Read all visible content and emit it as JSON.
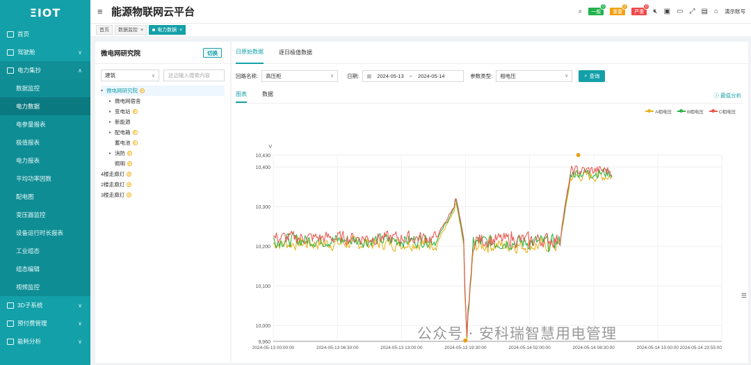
{
  "app": {
    "logo": "ΞIOT",
    "title": "能源物联网云平台"
  },
  "header": {
    "alerts": [
      {
        "label": "一般",
        "count": "0",
        "color": "#21b24b"
      },
      {
        "label": "重要",
        "count": "0",
        "color": "#f0a012"
      },
      {
        "label": "严重",
        "count": "0",
        "color": "#f0484a"
      }
    ],
    "user": "演示账号"
  },
  "sidebar": {
    "items": [
      {
        "label": "首页"
      },
      {
        "label": "驾驶舱",
        "has_children": true
      },
      {
        "label": "电力集抄",
        "has_children": true,
        "open": true
      }
    ],
    "sub_items": [
      {
        "label": "数据监控"
      },
      {
        "label": "电力数据",
        "active": true
      },
      {
        "label": "电参量报表"
      },
      {
        "label": "极值报表"
      },
      {
        "label": "电力报表"
      },
      {
        "label": "平均功率因数"
      },
      {
        "label": "配电图"
      },
      {
        "label": "变压器监控"
      },
      {
        "label": "设备运行时长报表"
      },
      {
        "label": "工业组态"
      },
      {
        "label": "组态编辑"
      },
      {
        "label": "视频监控"
      }
    ],
    "bottom_items": [
      {
        "label": "3D子系统"
      },
      {
        "label": "预付费管理"
      },
      {
        "label": "能耗分析"
      }
    ]
  },
  "tabs": [
    {
      "label": "首页"
    },
    {
      "label": "数据监控"
    },
    {
      "label": "电力数据",
      "active": true
    }
  ],
  "tree_panel": {
    "title": "微电网研究院",
    "switch_label": "切换",
    "filter_value": "建筑",
    "search_placeholder": "这边输入搜索内容",
    "nodes": [
      {
        "label": "微电网研究院",
        "level": 0,
        "expanded": true,
        "selected": true,
        "flash": true
      },
      {
        "label": "微电网宿舍",
        "level": 1,
        "arrow": true
      },
      {
        "label": "变电站",
        "level": 1,
        "arrow": true,
        "flash": true
      },
      {
        "label": "新能源",
        "level": 1,
        "arrow": true
      },
      {
        "label": "配电箱",
        "level": 1,
        "arrow": true,
        "flash": true
      },
      {
        "label": "蓄电池",
        "level": 1,
        "flash": true
      },
      {
        "label": "消防",
        "level": 1,
        "arrow": true,
        "flash": true
      },
      {
        "label": "照明",
        "level": 1,
        "flash": true
      },
      {
        "label": "4楼走廊灯",
        "level": 0,
        "flash": true
      },
      {
        "label": "2楼走廊灯",
        "level": 0,
        "flash": true
      },
      {
        "label": "3楼走廊灯",
        "level": 0,
        "flash": true
      }
    ]
  },
  "main": {
    "tabs": [
      {
        "label": "日原始数据",
        "active": true
      },
      {
        "label": "逐日极值数据"
      }
    ],
    "query": {
      "circuit_label": "回路名称:",
      "circuit_value": "高压柜",
      "date_label": "日期:",
      "date_start": "2024-05-13",
      "date_sep": "~",
      "date_end": "2024-05-14",
      "param_label": "参数类型:",
      "param_value": "相电压",
      "search_button": "查询"
    },
    "sub_tabs": [
      {
        "label": "图表",
        "active": true
      },
      {
        "label": "数据"
      }
    ],
    "analysis_link": "最值分析"
  },
  "chart_data": {
    "type": "line",
    "ylabel": "V",
    "ylim": [
      9960,
      10430
    ],
    "yticks": [
      "10,430",
      "10,400",
      "10,300",
      "10,200",
      "10,100",
      "10,000",
      "9,960"
    ],
    "xticks": [
      "2024-05-13 00:00:00",
      "2024-05-13 06:30:00",
      "2024-05-13 13:00:00",
      "2024-05-13 19:30:00",
      "2024-05-14 02:00:00",
      "2024-05-14 08:30:00",
      "2024-05-14 15:00:00",
      "2024-05-14 23:55:00"
    ],
    "series": [
      {
        "name": "A相电压",
        "color": "#e6b422"
      },
      {
        "name": "B相电压",
        "color": "#2fb344"
      },
      {
        "name": "C相电压",
        "color": "#e85a50"
      }
    ],
    "segments": [
      {
        "from": 0,
        "to": 0.365,
        "base": 10215,
        "amp": 22
      },
      {
        "from": 0.365,
        "to": 0.405,
        "ramp": [
          10220,
          10300
        ]
      },
      {
        "from": 0.405,
        "to": 0.425,
        "ramp": [
          10330,
          10200
        ]
      },
      {
        "from": 0.425,
        "to": 0.432,
        "ramp": [
          10150,
          9960
        ]
      },
      {
        "from": 0.432,
        "to": 0.445,
        "ramp": [
          10000,
          10190
        ]
      },
      {
        "from": 0.445,
        "to": 0.64,
        "base": 10210,
        "amp": 24
      },
      {
        "from": 0.64,
        "to": 0.665,
        "ramp": [
          10230,
          10400
        ]
      },
      {
        "from": 0.665,
        "to": 0.755,
        "base": 10385,
        "amp": 18
      }
    ],
    "markers": [
      {
        "x_frac": 0.428,
        "y": 9962
      },
      {
        "x_frac": 0.68,
        "y": 10430
      }
    ]
  },
  "watermark": "公众号 · 安科瑞智慧用电管理"
}
